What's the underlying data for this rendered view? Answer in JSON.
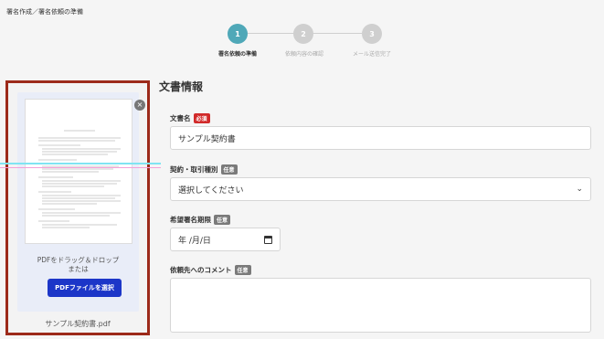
{
  "breadcrumb": "署名作成／署名依頼の準備",
  "stepper": {
    "steps": [
      {
        "number": "1",
        "label": "署名依頼の準備",
        "state": "active"
      },
      {
        "number": "2",
        "label": "依頼内容の確認",
        "state": "inactive"
      },
      {
        "number": "3",
        "label": "メール送信完了",
        "state": "inactive"
      }
    ]
  },
  "upload": {
    "drop_text_line1": "PDFをドラッグ＆ドロップ",
    "drop_text_line2": "または",
    "select_button": "PDFファイルを選択",
    "file_name": "サンプル契約書.pdf",
    "close_icon": "×"
  },
  "form": {
    "section_title": "文書情報",
    "doc_name": {
      "label": "文書名",
      "badge": "必須",
      "value": "サンプル契約書"
    },
    "contract_type": {
      "label": "契約・取引種別",
      "badge": "任意",
      "value": "選択してください"
    },
    "deadline": {
      "label": "希望署名期限",
      "badge": "任意",
      "placeholder": "年 /月/日"
    },
    "comment": {
      "label": "依頼先へのコメント",
      "badge": "任意",
      "value": ""
    }
  },
  "colors": {
    "accent": "#4fa8b8",
    "primary_button": "#1c36c8",
    "required_badge": "#d12a2a",
    "highlight_border": "#9c2a1a"
  }
}
